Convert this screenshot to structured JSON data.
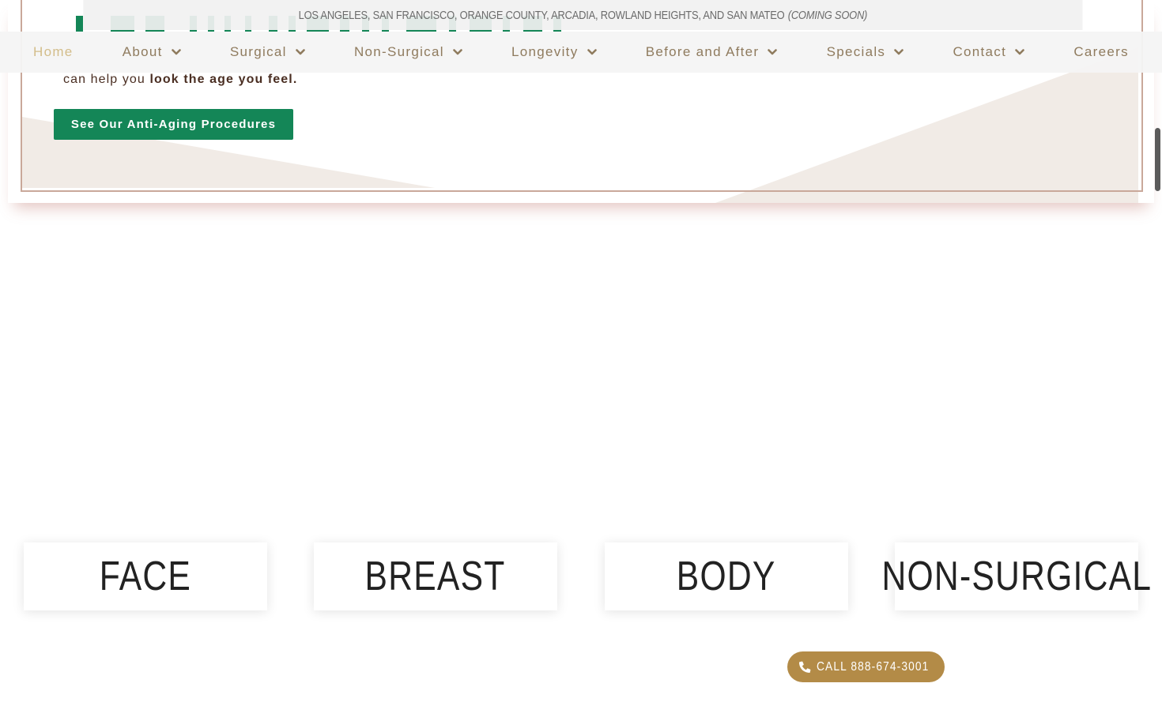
{
  "locations_bar": {
    "locations": "LOS ANGELES, SAN FRANCISCO, ORANGE COUNTY, ARCADIA, ROWLAND HEIGHTS, AND SAN MATEO",
    "coming_soon": "(COMING SOON)"
  },
  "nav": {
    "items": [
      {
        "label": "Home",
        "active": true,
        "has_dropdown": false
      },
      {
        "label": "About",
        "active": false,
        "has_dropdown": true
      },
      {
        "label": "Surgical",
        "active": false,
        "has_dropdown": true
      },
      {
        "label": "Non-Surgical",
        "active": false,
        "has_dropdown": true
      },
      {
        "label": "Longevity",
        "active": false,
        "has_dropdown": true
      },
      {
        "label": "Before and After",
        "active": false,
        "has_dropdown": true
      },
      {
        "label": "Specials",
        "active": false,
        "has_dropdown": true
      },
      {
        "label": "Contact",
        "active": false,
        "has_dropdown": true
      },
      {
        "label": "Careers",
        "active": false,
        "has_dropdown": false
      }
    ],
    "dropdown_icon": "chevron-down-icon"
  },
  "hero": {
    "intro_prefix": "can help you ",
    "intro_bold": "look the age you feel.",
    "cta_label": "See Our Anti-Aging Procedures"
  },
  "categories": [
    {
      "label": "FACE"
    },
    {
      "label": "BREAST"
    },
    {
      "label": "BODY"
    },
    {
      "label": "NON-SURGICAL"
    }
  ],
  "call": {
    "label": "CALL 888-674-3001",
    "icon": "phone-icon"
  },
  "colors": {
    "brand_green": "#148657",
    "gold_accent": "#b38b47",
    "nav_text": "#8f7b5e",
    "nav_active": "#d3bd8a",
    "hero_text": "#4a2e22"
  }
}
